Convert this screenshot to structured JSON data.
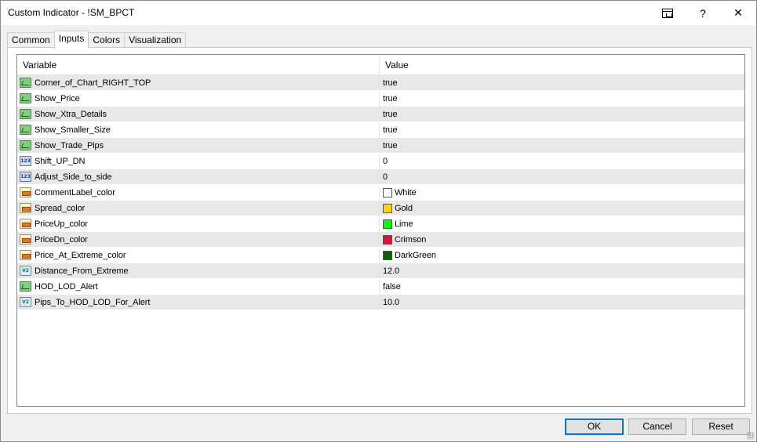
{
  "window": {
    "title": "Custom Indicator - !SM_BPCT",
    "help_label": "?",
    "close_label": "✕"
  },
  "tabs": [
    {
      "label": "Common"
    },
    {
      "label": "Inputs"
    },
    {
      "label": "Colors"
    },
    {
      "label": "Visualization"
    }
  ],
  "active_tab": "Inputs",
  "grid": {
    "headers": {
      "variable": "Variable",
      "value": "Value"
    },
    "rows": [
      {
        "type": "bool",
        "name": "Corner_of_Chart_RIGHT_TOP",
        "value": "true"
      },
      {
        "type": "bool",
        "name": "Show_Price",
        "value": "true"
      },
      {
        "type": "bool",
        "name": "Show_Xtra_Details",
        "value": "true"
      },
      {
        "type": "bool",
        "name": "Show_Smaller_Size",
        "value": "true"
      },
      {
        "type": "bool",
        "name": "Show_Trade_Pips",
        "value": "true"
      },
      {
        "type": "int",
        "name": "Shift_UP_DN",
        "value": "0"
      },
      {
        "type": "int",
        "name": "Adjust_Side_to_side",
        "value": "0"
      },
      {
        "type": "color",
        "name": "CommentLabel_color",
        "value": "White",
        "swatch": "#ffffff"
      },
      {
        "type": "color",
        "name": "Spread_color",
        "value": "Gold",
        "swatch": "#ffd700"
      },
      {
        "type": "color",
        "name": "PriceUp_color",
        "value": "Lime",
        "swatch": "#00ff00"
      },
      {
        "type": "color",
        "name": "PriceDn_color",
        "value": "Crimson",
        "swatch": "#dc143c"
      },
      {
        "type": "color",
        "name": "Price_At_Extreme_color",
        "value": "DarkGreen",
        "swatch": "#006400"
      },
      {
        "type": "double",
        "name": "Distance_From_Extreme",
        "value": "12.0"
      },
      {
        "type": "bool",
        "name": "HOD_LOD_Alert",
        "value": "false"
      },
      {
        "type": "double",
        "name": "Pips_To_HOD_LOD_For_Alert",
        "value": "10.0"
      }
    ]
  },
  "buttons": {
    "ok": "OK",
    "cancel": "Cancel",
    "reset": "Reset"
  },
  "icon_labels": {
    "int": "123",
    "double": "V2"
  }
}
